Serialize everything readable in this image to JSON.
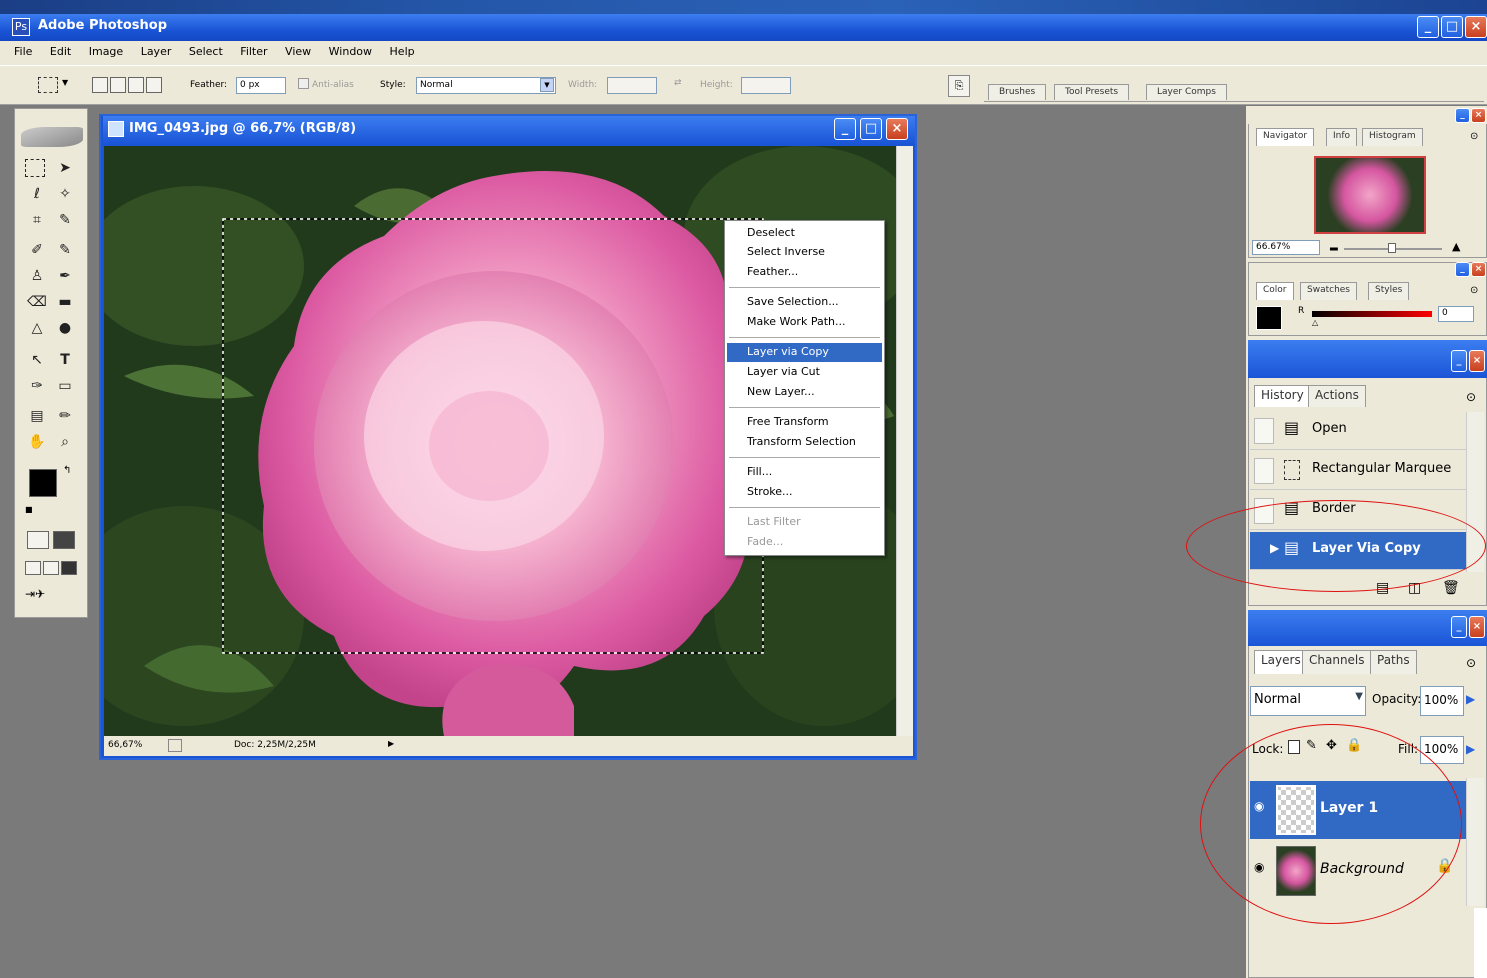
{
  "app": {
    "title": "Adobe Photoshop"
  },
  "menu": [
    "File",
    "Edit",
    "Image",
    "Layer",
    "Select",
    "Filter",
    "View",
    "Window",
    "Help"
  ],
  "options": {
    "feather_label": "Feather:",
    "feather_value": "0 px",
    "antialias_label": "Anti-alias",
    "style_label": "Style:",
    "style_value": "Normal",
    "width_label": "Width:",
    "height_label": "Height:",
    "well_tabs": [
      "Brushes",
      "Tool Presets",
      "Layer Comps"
    ]
  },
  "document": {
    "title": "IMG_0493.jpg @ 66,7% (RGB/8)",
    "zoom": "66,67%",
    "doc_size": "Doc: 2,25M/2,25M"
  },
  "context_menu": {
    "groups": [
      [
        {
          "label": "Deselect"
        },
        {
          "label": "Select Inverse"
        },
        {
          "label": "Feather..."
        }
      ],
      [
        {
          "label": "Save Selection..."
        },
        {
          "label": "Make Work Path..."
        }
      ],
      [
        {
          "label": "Layer via Copy",
          "selected": true
        },
        {
          "label": "Layer via Cut"
        },
        {
          "label": "New Layer..."
        }
      ],
      [
        {
          "label": "Free Transform"
        },
        {
          "label": "Transform Selection"
        }
      ],
      [
        {
          "label": "Fill..."
        },
        {
          "label": "Stroke..."
        }
      ],
      [
        {
          "label": "Last Filter",
          "disabled": true
        },
        {
          "label": "Fade...",
          "disabled": true
        }
      ]
    ]
  },
  "navigator": {
    "tabs": [
      "Navigator",
      "Info",
      "Histogram"
    ],
    "zoom": "66.67%"
  },
  "color": {
    "tabs": [
      "Color",
      "Swatches",
      "Styles"
    ],
    "channel": "R",
    "value": "0"
  },
  "history": {
    "tabs": [
      "History",
      "Actions"
    ],
    "items": [
      {
        "label": "Open"
      },
      {
        "label": "Rectangular Marquee"
      },
      {
        "label": "Border"
      },
      {
        "label": "Layer Via Copy",
        "selected": true
      }
    ]
  },
  "layers": {
    "tabs": [
      "Layers",
      "Channels",
      "Paths"
    ],
    "blend_mode": "Normal",
    "opacity_label": "Opacity:",
    "opacity": "100%",
    "lock_label": "Lock:",
    "fill_label": "Fill:",
    "fill": "100%",
    "items": [
      {
        "name": "Layer 1",
        "selected": true
      },
      {
        "name": "Background"
      }
    ]
  },
  "colors": {
    "selection": "#316ac5",
    "title_blue": "#1a55d6",
    "annotation": "#e01010"
  }
}
